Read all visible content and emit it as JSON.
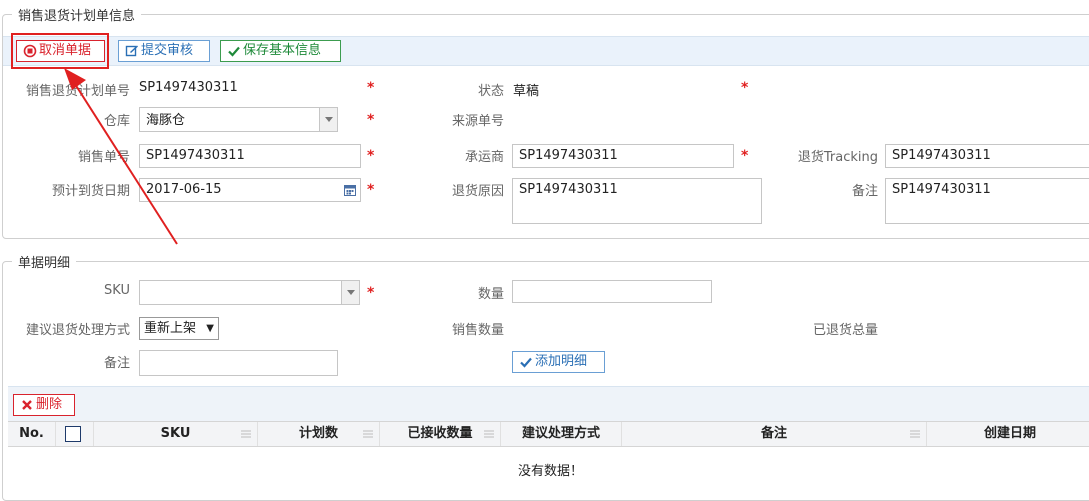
{
  "section1": {
    "legend": "销售退货计划单信息",
    "buttons": {
      "cancel": "取消单据",
      "submit": "提交审核",
      "save": "保存基本信息"
    },
    "fields": {
      "plan_no_label": "销售退货计划单号",
      "plan_no_value": "SP1497430311",
      "status_label": "状态",
      "status_value": "草稿",
      "warehouse_label": "仓库",
      "warehouse_value": "海豚仓",
      "source_no_label": "来源单号",
      "sales_no_label": "销售单号",
      "sales_no_value": "SP1497430311",
      "carrier_label": "承运商",
      "carrier_value": "SP1497430311",
      "tracking_label": "退货Tracking",
      "tracking_value": "SP1497430311",
      "arrival_date_label": "预计到货日期",
      "arrival_date_value": "2017-06-15",
      "reason_label": "退货原因",
      "reason_value": "SP1497430311",
      "remark_label": "备注",
      "remark_value": "SP1497430311"
    }
  },
  "section2": {
    "legend": "单据明细",
    "sku_label": "SKU",
    "qty_label": "数量",
    "method_label": "建议退货处理方式",
    "method_value": "重新上架",
    "sales_qty_label": "销售数量",
    "returned_total_label": "已退货总量",
    "remark_label": "备注",
    "add_button": "添加明细",
    "delete_button": "删除",
    "table": {
      "columns": [
        "No.",
        "",
        "SKU",
        "计划数",
        "已接收数量",
        "建议处理方式",
        "备注",
        "创建日期"
      ],
      "empty": "没有数据！"
    }
  },
  "colors": {
    "accent_red": "#d9232d",
    "blue": "#2a6fb5",
    "green": "#1f8a3a",
    "toolbar_bg": "#eaf2fb"
  }
}
